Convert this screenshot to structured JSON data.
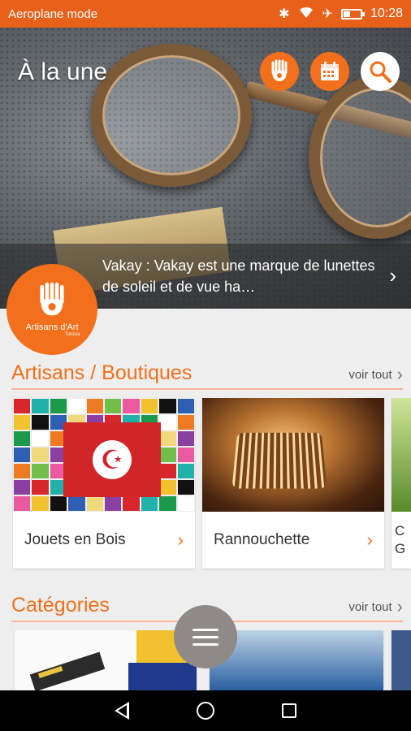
{
  "status_bar": {
    "left_text": "Aeroplane mode",
    "time": "10:28",
    "icons": [
      "bluetooth-icon",
      "wifi-icon",
      "airplane-icon",
      "battery-icon"
    ]
  },
  "hero": {
    "title": "À la une",
    "caption": "Vakay : Vakay est une marque de lunettes de soleil et de vue ha…",
    "actions": [
      "artisan-hand-icon",
      "calendar-icon",
      "search-icon"
    ]
  },
  "logo": {
    "line1": "Artisans d'Art",
    "line2": "Tunisia"
  },
  "artisans_section": {
    "title": "Artisans / Boutiques",
    "see_all": "voir tout",
    "cards": [
      {
        "label": "Jouets en Bois"
      },
      {
        "label": "Rannouchette"
      },
      {
        "label": "C G"
      }
    ]
  },
  "categories_section": {
    "title": "Catégories",
    "see_all": "voir tout"
  },
  "colors": {
    "accent": "#f26f1b",
    "status_bar": "#e8611a"
  }
}
